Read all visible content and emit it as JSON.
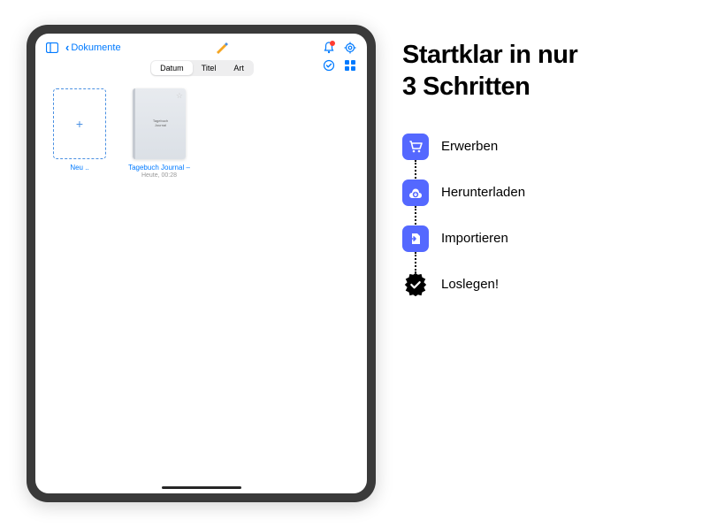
{
  "tablet": {
    "back_label": "Dokumente",
    "segmented": {
      "date": "Datum",
      "title": "Titel",
      "kind": "Art"
    },
    "new_tile": {
      "plus": "+",
      "label": "Neu .."
    },
    "journal": {
      "cover_line1": "Tagebuch",
      "cover_line2": "Journal",
      "label": "Tagebuch Journal –",
      "sublabel": "Heute, 00:28"
    }
  },
  "right": {
    "headline_l1": "Startklar in nur",
    "headline_l2": "3 Schritten",
    "steps": {
      "s1": "Erwerben",
      "s2": "Herunterladen",
      "s3": "Importieren",
      "s4": "Loslegen!"
    }
  }
}
